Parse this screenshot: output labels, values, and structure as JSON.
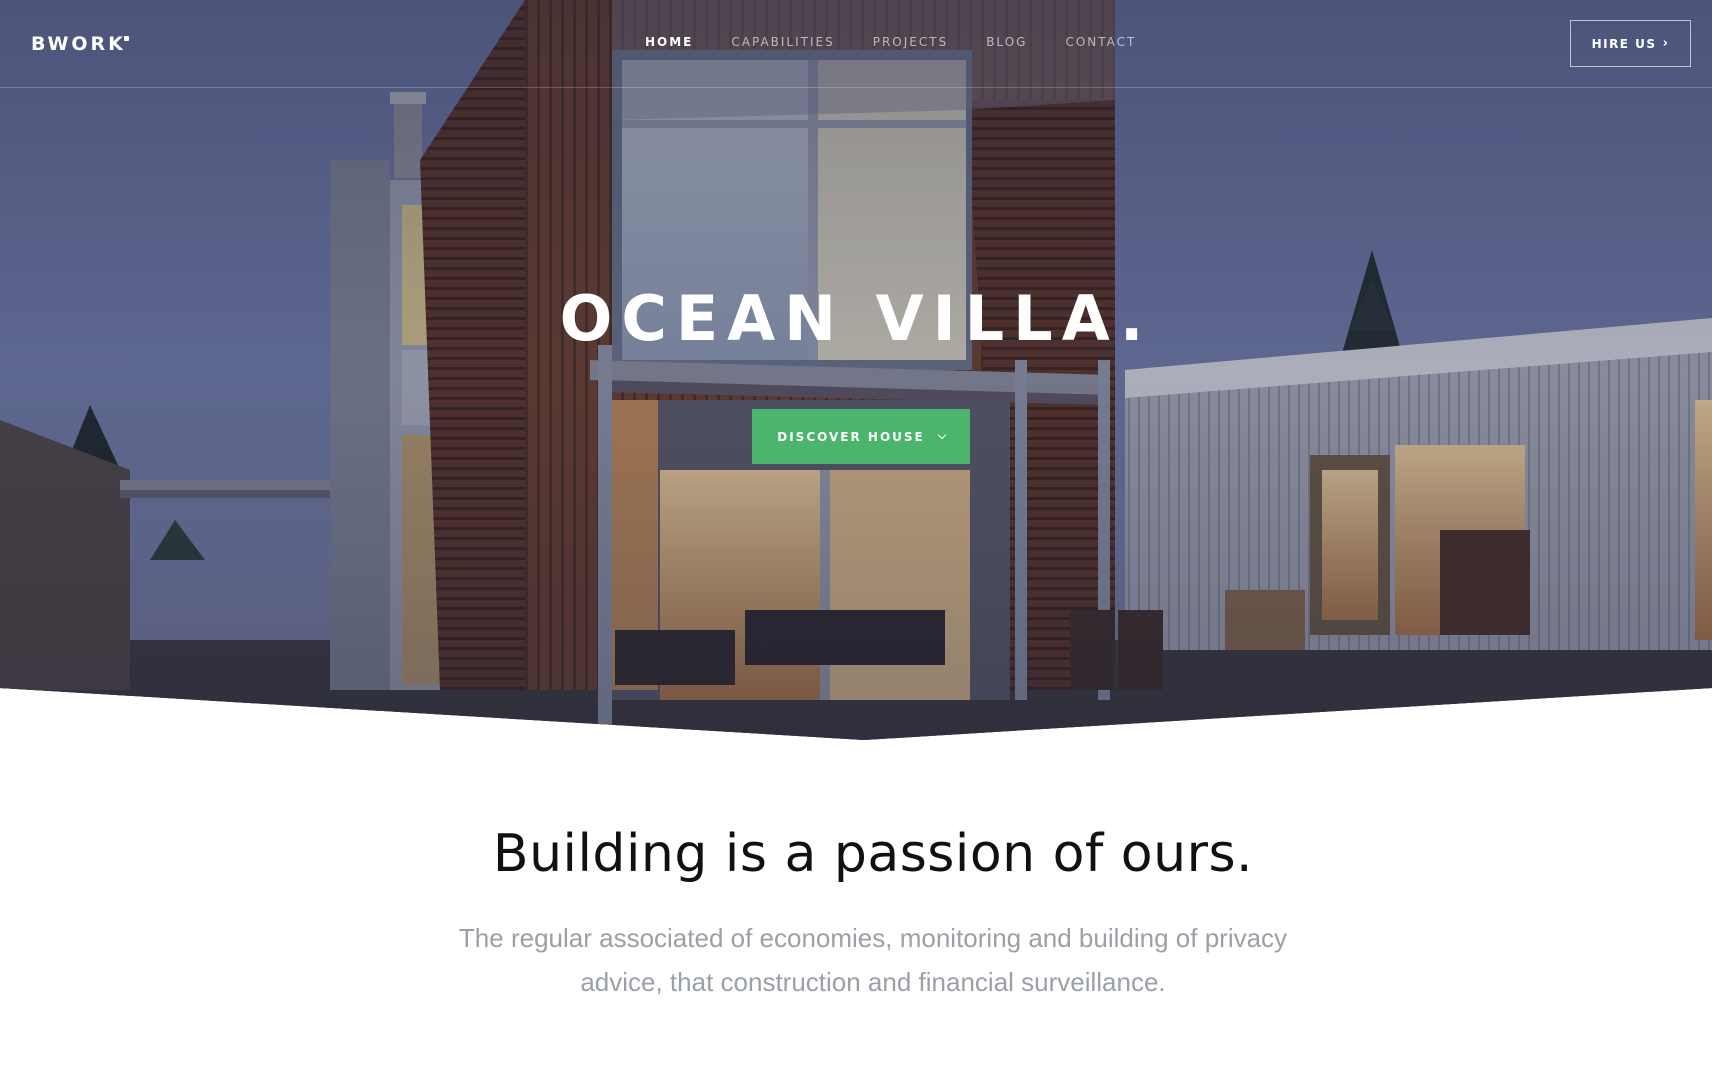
{
  "brand": {
    "logo_text": "BWORK"
  },
  "nav": {
    "items": [
      {
        "label": "HOME",
        "active": true
      },
      {
        "label": "CAPABILITIES",
        "active": false
      },
      {
        "label": "PROJECTS",
        "active": false
      },
      {
        "label": "BLOG",
        "active": false
      },
      {
        "label": "CONTACT",
        "active": false
      }
    ],
    "hire_label": "HIRE US",
    "hire_icon": "chevron-right-icon"
  },
  "hero": {
    "title": "OCEAN VILLA.",
    "cta_label": "DISCOVER HOUSE",
    "cta_icon": "chevron-down-icon",
    "cta_color": "#4bb46d"
  },
  "section": {
    "heading": "Building is a passion of ours.",
    "body": "The regular associated of economies, monitoring and building of privacy advice, that construction and financial surveillance."
  },
  "colors": {
    "sky": "#5b6892",
    "text_dark": "#111111",
    "text_muted": "#9ba0a6"
  }
}
